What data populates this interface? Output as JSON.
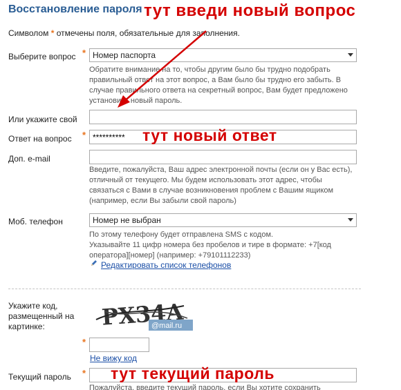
{
  "heading": "Восстановление пароля",
  "required_note": {
    "prefix": "Символом",
    "star": "*",
    "suffix": "отмечены поля, обязательные для заполнения."
  },
  "fields": {
    "question": {
      "label": "Выберите вопрос",
      "value": "Номер паспорта",
      "hint": [
        "Обратите внимание на то, чтобы другим было бы трудно подобрать",
        "правильный ответ на этот вопрос, а Вам было бы трудно его забыть. В",
        "случае правильного ответа на секретный вопрос, Вам будет предложено",
        "установить новый пароль."
      ]
    },
    "own_question": {
      "label": "Или укажите свой",
      "value": ""
    },
    "answer": {
      "label": "Ответ на вопрос",
      "value": "**********"
    },
    "extra_email": {
      "label": "Доп. e-mail",
      "value": "",
      "hint": [
        "Введите, пожалуйста, Ваш адрес электронной почты (если он у Вас есть),",
        "отличный от текущего. Мы будем использовать этот адрес, чтобы",
        "связаться с Вами в случае возникновения проблем с Вашим ящиком",
        "(например, если Вы забыли свой пароль)"
      ]
    },
    "phone": {
      "label": "Моб. телефон",
      "value": "Номер не выбран",
      "hint": [
        "По этому телефону будет отправлена SMS с кодом.",
        "Указывайте 11 цифр номера без пробелов и тире в формате: +7[код",
        "оператора][номер] (например: +79101112233)"
      ],
      "edit_link": "Редактировать список телефонов"
    },
    "captcha": {
      "label": [
        "Укажите код,",
        "размещенный на",
        "картинке:"
      ],
      "image_text": "PX34A",
      "brand": "@mail.ru",
      "value": "",
      "cant_see": "Не вижу код"
    },
    "current_password": {
      "label": "Текущий пароль",
      "value": "",
      "hint": "Пожалуйста, введите текущий пароль, если Вы хотите сохранить"
    }
  },
  "required_star": "*",
  "annotations": {
    "new_question": "тут введи новый вопрос",
    "new_answer": "тут новый ответ",
    "current_password": "тут текущий пароль"
  },
  "colors": {
    "heading": "#2a5d94",
    "required": "#e8731d",
    "link": "#1a4ea6",
    "annotation": "#d40000"
  }
}
